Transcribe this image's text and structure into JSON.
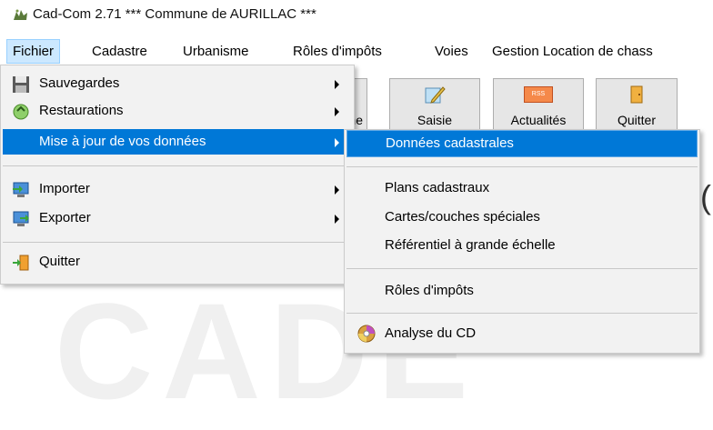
{
  "window": {
    "title": "Cad-Com 2.71 *** Commune de AURILLAC ***"
  },
  "menubar": {
    "items": [
      {
        "label": "Fichier"
      },
      {
        "label": "Cadastre"
      },
      {
        "label": "Urbanisme"
      },
      {
        "label": "Rôles d'impôts"
      },
      {
        "label": "Voies"
      },
      {
        "label": "Gestion Location de chass"
      }
    ]
  },
  "toolbar": {
    "urbanisme_partial": "sme",
    "saisie": "Saisie",
    "actualites": "Actualités",
    "rss": "RSS",
    "quitter": "Quitter"
  },
  "fichier_menu": {
    "sauvegardes": "Sauvegardes",
    "restaurations": "Restaurations",
    "mise_a_jour": "Mise à jour de vos données",
    "importer": "Importer",
    "exporter": "Exporter",
    "quitter": "Quitter"
  },
  "submenu": {
    "donnees_cadastrales": "Données cadastrales",
    "plans_cadastraux": "Plans cadastraux",
    "cartes_couches": "Cartes/couches spéciales",
    "referentiel": "Référentiel à grande échelle",
    "roles_impots": "Rôles d'impôts",
    "analyse_cd": "Analyse du CD"
  },
  "colors": {
    "highlight": "#0078d7",
    "menu_bg": "#f2f2f2",
    "menubar_active": "#cce8ff"
  }
}
